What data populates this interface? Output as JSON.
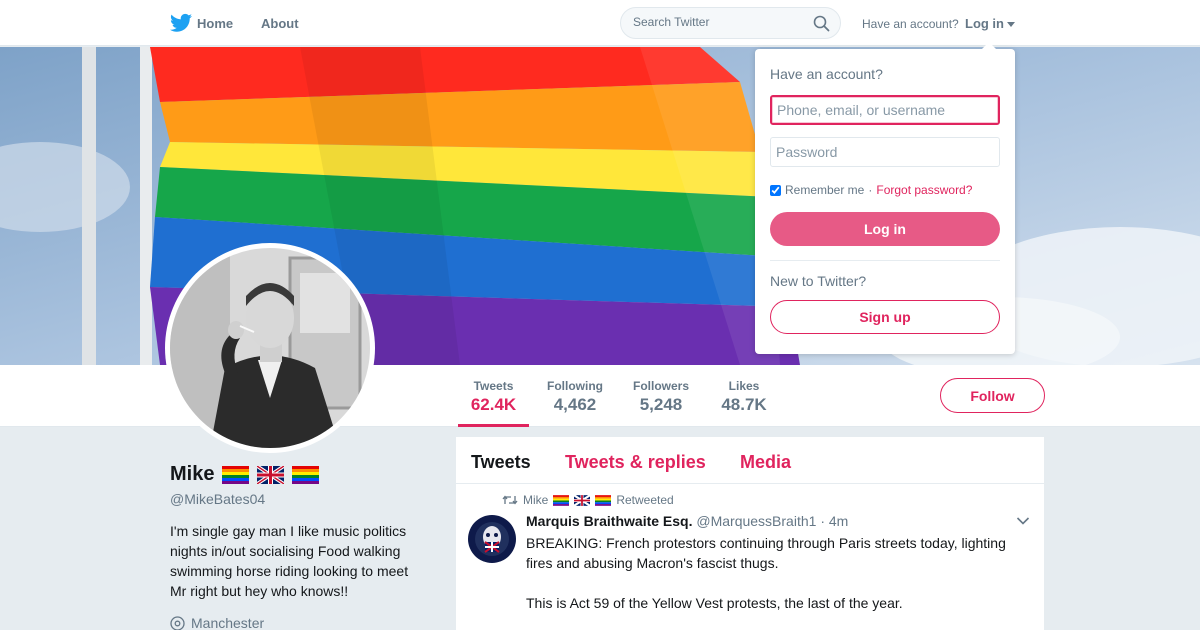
{
  "nav": {
    "logo_icon": "twitter-bird-icon",
    "home_label": "Home",
    "about_label": "About",
    "search_placeholder": "Search Twitter",
    "have_account_text": "Have an account?",
    "login_label": "Log in",
    "accent_color": "#1da1f2"
  },
  "profile": {
    "name": "Mike",
    "name_flags": [
      "rainbow-flag-icon",
      "uk-flag-icon",
      "rainbow-flag-icon"
    ],
    "handle": "@MikeBates04",
    "bio": "I'm single gay man I like music politics nights in/out socialising Food walking swimming horse riding looking to meet Mr right but hey who knows!!",
    "location": "Manchester",
    "follow_label": "Follow",
    "stats": [
      {
        "label": "Tweets",
        "value": "62.4K"
      },
      {
        "label": "Following",
        "value": "4,462"
      },
      {
        "label": "Followers",
        "value": "5,248"
      },
      {
        "label": "Likes",
        "value": "48.7K"
      }
    ],
    "theme_color": "#e0245e"
  },
  "timeline": {
    "tabs": [
      {
        "label": "Tweets"
      },
      {
        "label": "Tweets & replies"
      },
      {
        "label": "Media"
      }
    ],
    "tweet": {
      "retweeter": "Mike",
      "retweeted_label": "Retweeted",
      "author_name": "Marquis Braithwaite Esq.",
      "author_handle": "@MarquessBraith1",
      "separator": "·",
      "time": "4m",
      "text_1": "BREAKING: French protestors continuing through Paris streets today, lighting fires and abusing Macron's fascist thugs.",
      "text_2": "This is Act 59 of the Yellow Vest protests, the last of the year."
    }
  },
  "login_dropdown": {
    "title": "Have an account?",
    "username_placeholder": "Phone, email, or username",
    "password_placeholder": "Password",
    "remember_label": "Remember me",
    "separator": "·",
    "forgot_label": "Forgot password?",
    "login_button": "Log in",
    "new_to_text": "New to Twitter?",
    "signup_button": "Sign up"
  }
}
